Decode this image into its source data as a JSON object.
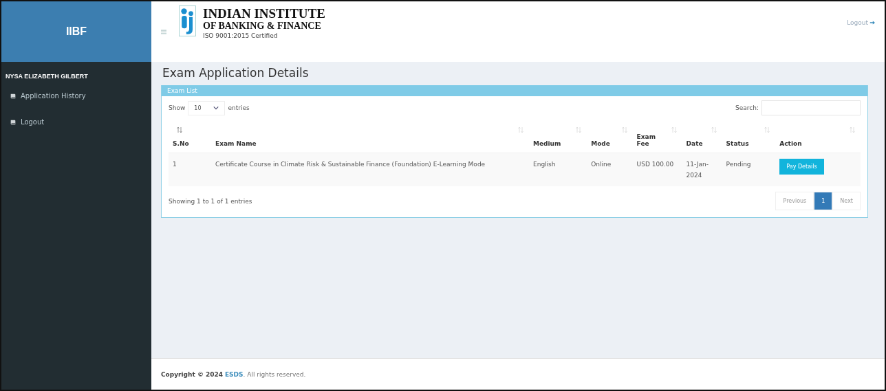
{
  "brand": "IIBF",
  "logo": {
    "line1": "INDIAN INSTITUTE",
    "line2": "OF BANKING & FINANCE",
    "line3": "ISO 9001:2015 Certified"
  },
  "header": {
    "logout": "Logout"
  },
  "sidebar": {
    "user": "NYSA ELIZABETH GILBERT",
    "items": [
      {
        "label": "Application History"
      },
      {
        "label": "Logout"
      }
    ]
  },
  "page_title": "Exam Application Details",
  "panel": {
    "title": "Exam List",
    "show_label": "Show",
    "page_size": "10",
    "entries_label": "entries",
    "search_label": "Search:",
    "columns": [
      {
        "label": "S.No",
        "sorted": true
      },
      {
        "label": "Exam Name",
        "sorted": false
      },
      {
        "label": "Medium",
        "sorted": false
      },
      {
        "label": "Mode",
        "sorted": false
      },
      {
        "label": "Exam Fee",
        "sorted": false
      },
      {
        "label": "Date",
        "sorted": false
      },
      {
        "label": "Status",
        "sorted": false
      },
      {
        "label": "Action",
        "sorted": false
      }
    ],
    "rows": [
      {
        "sno": "1",
        "exam_name": "Certificate Course in Climate Risk & Sustainable Finance (Foundation) E-Learning Mode",
        "medium": "English",
        "mode": "Online",
        "fee": "USD 100.00",
        "date": "11-Jan-2024",
        "status": "Pending",
        "action": "Pay Details"
      }
    ],
    "info": "Showing 1 to 1 of 1 entries",
    "pagination": [
      {
        "label": "Previous",
        "selected": false
      },
      {
        "label": "1",
        "selected": true
      },
      {
        "label": "Next",
        "selected": false
      }
    ]
  },
  "footer": {
    "prefix": "Copyright © 2024",
    "link": "ESDS",
    "suffix": ". All rights reserved."
  }
}
